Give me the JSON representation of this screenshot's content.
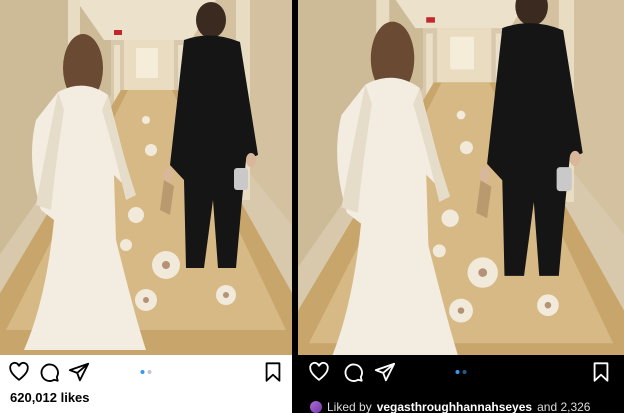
{
  "left_post": {
    "likes": "620,012 likes",
    "icons": [
      "heart-icon",
      "comment-icon",
      "share-icon",
      "bookmark-icon"
    ],
    "carousel_active": 0
  },
  "right_post": {
    "liked_prefix": "Liked by",
    "liked_user": "vegasthroughhannahseyes",
    "liked_suffix": "and 2,326",
    "icons": [
      "heart-icon",
      "comment-icon",
      "share-icon",
      "bookmark-icon"
    ],
    "carousel_active": 0
  },
  "colors": {
    "accent": "#3897f0",
    "carpet": "#c8a66b",
    "dress": "#f3ece0",
    "suit": "#151515"
  }
}
